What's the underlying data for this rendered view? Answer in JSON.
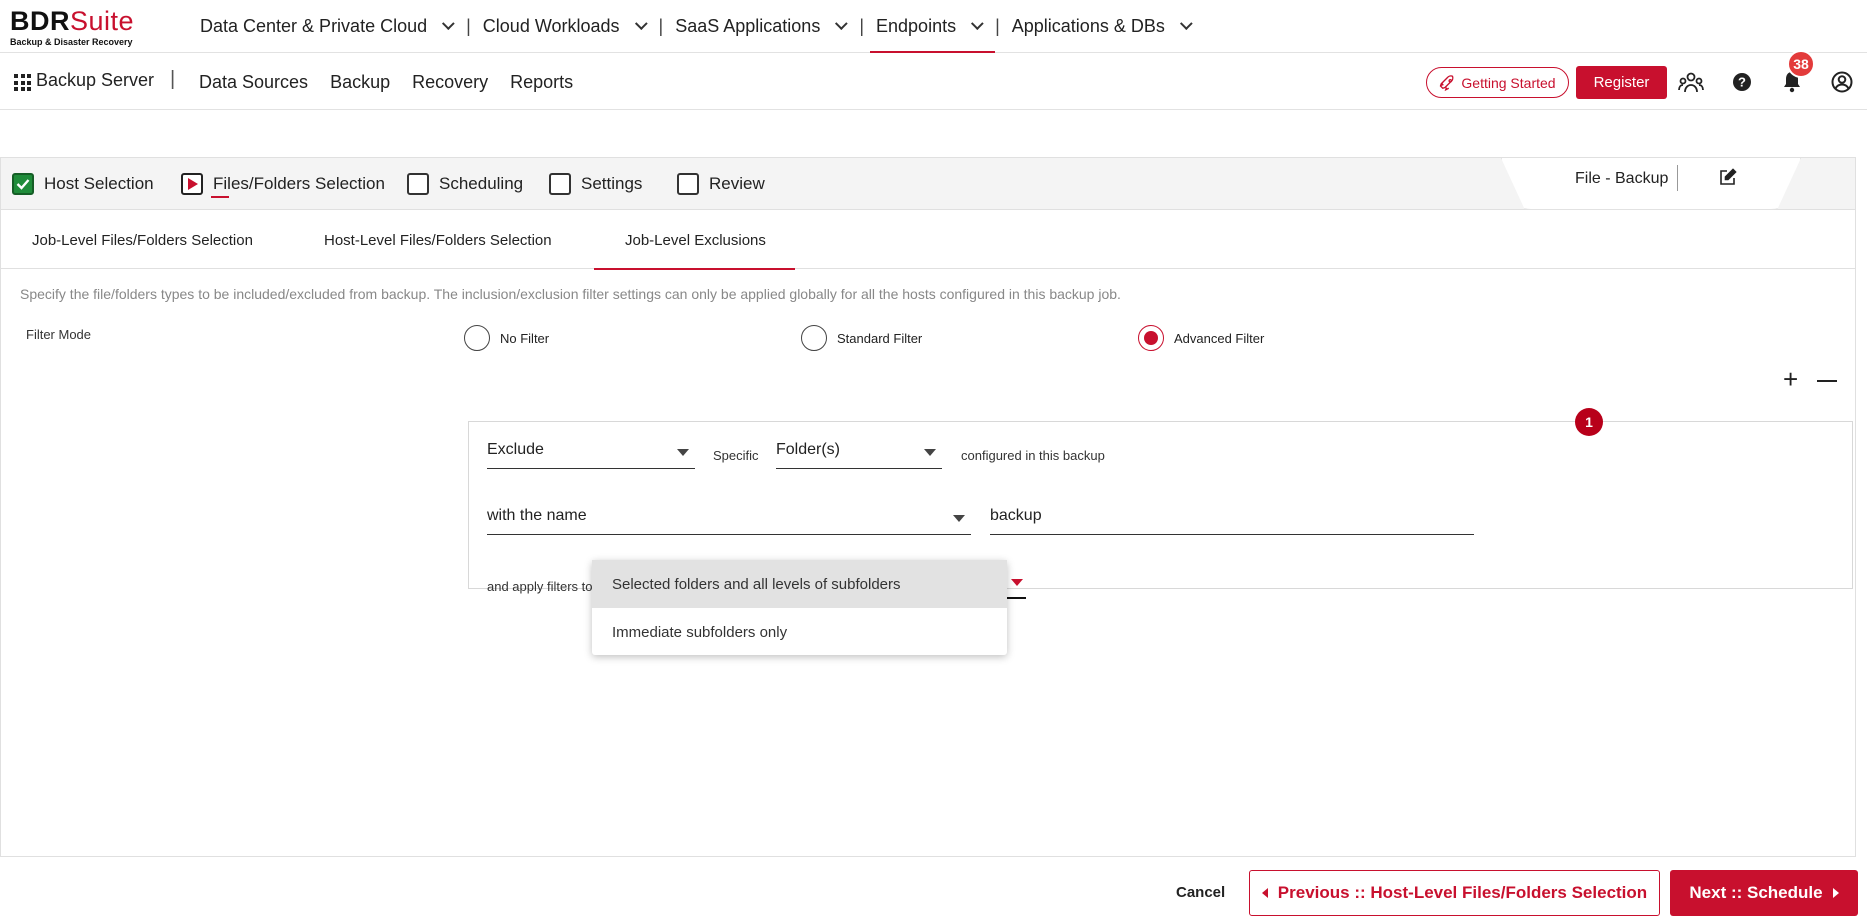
{
  "brand": {
    "logo_bold": "BDR",
    "logo_light": "Suite",
    "tagline": "Backup & Disaster Recovery",
    "accent_color": "#c8102e"
  },
  "top_menu": {
    "items": [
      {
        "label": "Data Center & Private Cloud",
        "active": false
      },
      {
        "label": "Cloud Workloads",
        "active": false
      },
      {
        "label": "SaaS Applications",
        "active": false
      },
      {
        "label": "Endpoints",
        "active": true
      },
      {
        "label": "Applications & DBs",
        "active": false
      }
    ],
    "separator": "|"
  },
  "sub_nav": {
    "title": "Backup Server",
    "separator": "|",
    "links": [
      "Data Sources",
      "Backup",
      "Recovery",
      "Reports"
    ],
    "getting_started": "Getting Started",
    "register": "Register",
    "notification_count": "38"
  },
  "wizard": {
    "steps": [
      {
        "label": "Host Selection",
        "state": "done"
      },
      {
        "label": "Files/Folders Selection",
        "state": "current"
      },
      {
        "label": "Scheduling",
        "state": "pending"
      },
      {
        "label": "Settings",
        "state": "pending"
      },
      {
        "label": "Review",
        "state": "pending"
      }
    ],
    "job_name": "File - Backup",
    "tabs": [
      {
        "label": "Job-Level Files/Folders Selection",
        "active": false
      },
      {
        "label": "Host-Level Files/Folders Selection",
        "active": false
      },
      {
        "label": "Job-Level Exclusions",
        "active": true
      }
    ],
    "description": "Specify the file/folders types to be included/excluded from backup. The inclusion/exclusion filter settings can only be applied globally for all the hosts configured in this backup job.",
    "filter_mode": {
      "label": "Filter Mode",
      "options": [
        "No Filter",
        "Standard Filter",
        "Advanced Filter"
      ],
      "selected": "Advanced Filter"
    },
    "rule": {
      "index": "1",
      "action": "Exclude",
      "specific_label": "Specific",
      "target": "Folder(s)",
      "configured_text": "configured in this backup",
      "condition": "with the name",
      "value": "backup",
      "apply_label": "and apply filters to",
      "apply_options": [
        "Selected folders and all levels of subfolders",
        "Immediate subfolders only"
      ]
    }
  },
  "footer": {
    "cancel": "Cancel",
    "previous": "Previous :: Host-Level Files/Folders Selection",
    "next": "Next :: Schedule"
  }
}
